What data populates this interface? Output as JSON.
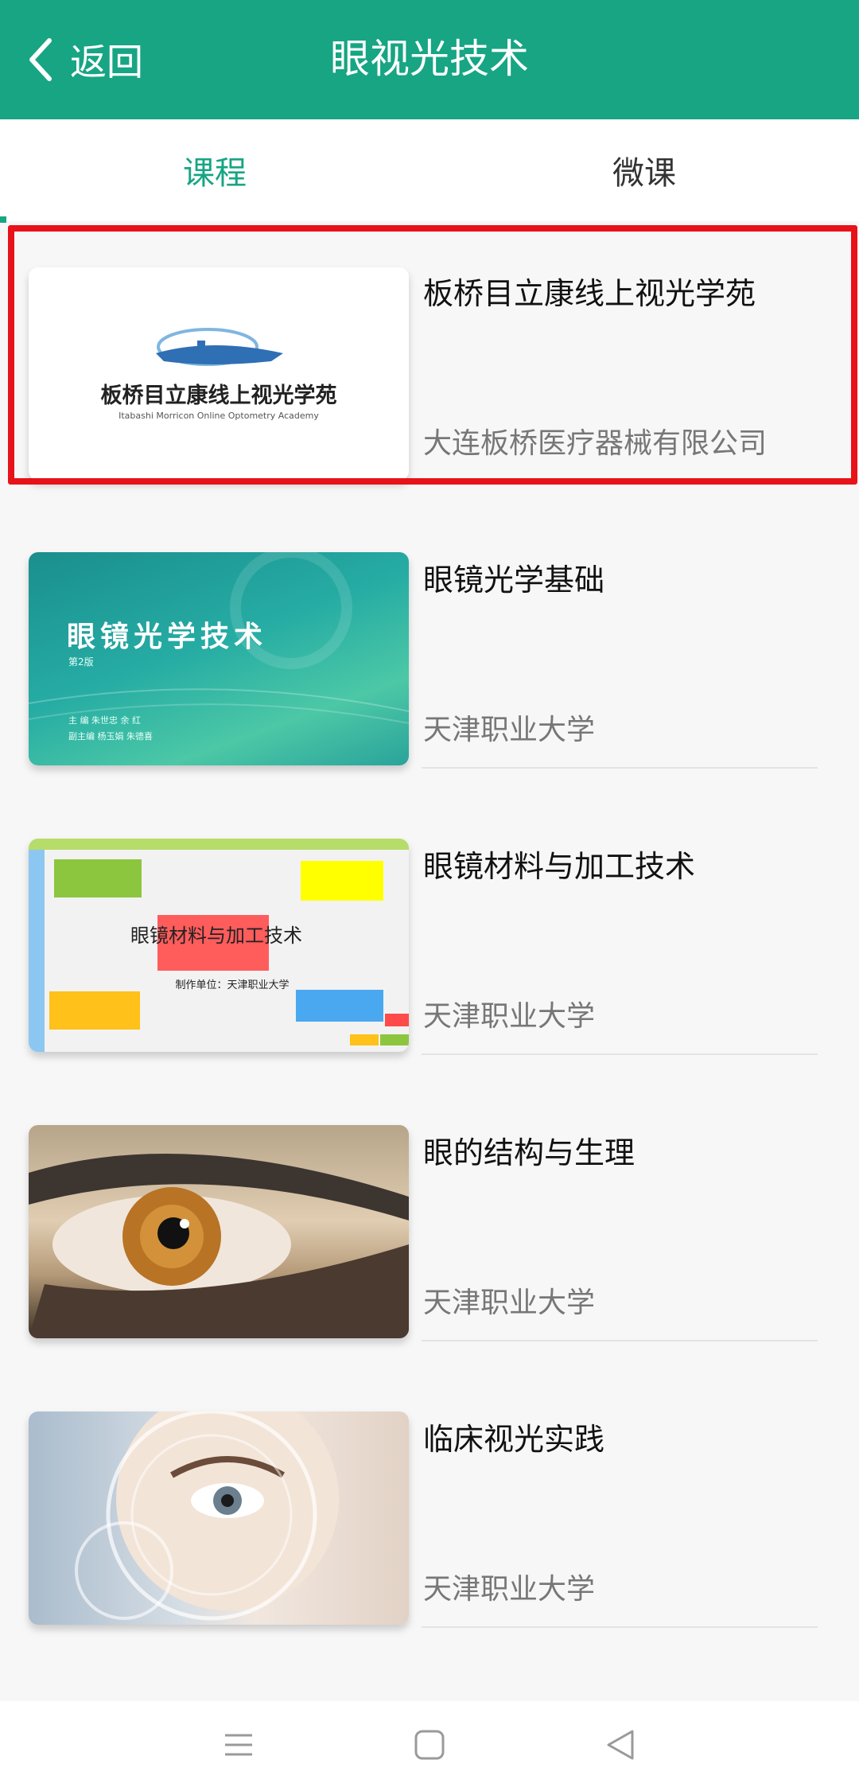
{
  "header": {
    "back_label": "返回",
    "title": "眼视光技术"
  },
  "tabs": [
    {
      "label": "课程",
      "active": true
    },
    {
      "label": "微课",
      "active": false
    }
  ],
  "courses": [
    {
      "title": "板桥目立康线上视光学苑",
      "provider": "大连板桥医疗器械有限公司",
      "thumb_text": "板桥目立康线上视光学苑",
      "thumb_subtext": "Itabashi Morricon Online Optometry Academy",
      "selected": true
    },
    {
      "title": "眼镜光学基础",
      "provider": "天津职业大学",
      "thumb_text": "眼镜光学技术",
      "thumb_subtext": "第2版",
      "thumb_credits": [
        "主 编  朱世忠  余 红",
        "副主编  杨玉娟  朱德喜"
      ]
    },
    {
      "title": "眼镜材料与加工技术",
      "provider": "天津职业大学",
      "thumb_text": "眼镜材料与加工技术",
      "thumb_subtext": "制作单位：天津职业大学"
    },
    {
      "title": "眼的结构与生理",
      "provider": "天津职业大学"
    },
    {
      "title": "临床视光实践",
      "provider": "天津职业大学"
    }
  ],
  "colors": {
    "accent": "#17a584",
    "highlight": "#e8121a"
  }
}
